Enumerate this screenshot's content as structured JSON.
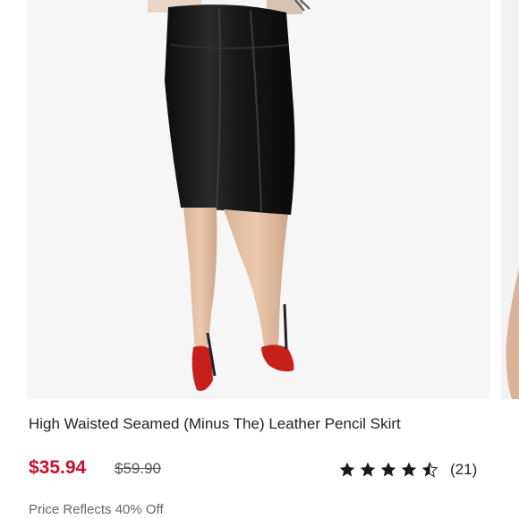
{
  "product": {
    "title": "High Waisted Seamed (Minus The) Leather Pencil Skirt",
    "image_icon": "product-photo-skirt",
    "price": "$35.94",
    "original_price": "$59.90",
    "rating": 4.5,
    "review_count": "(21)",
    "promo_note": "Price Reflects 40% Off"
  },
  "colors": {
    "sale_price": "#c8102e",
    "text": "#222222",
    "muted": "#666666",
    "star": "#1a1a1a"
  }
}
